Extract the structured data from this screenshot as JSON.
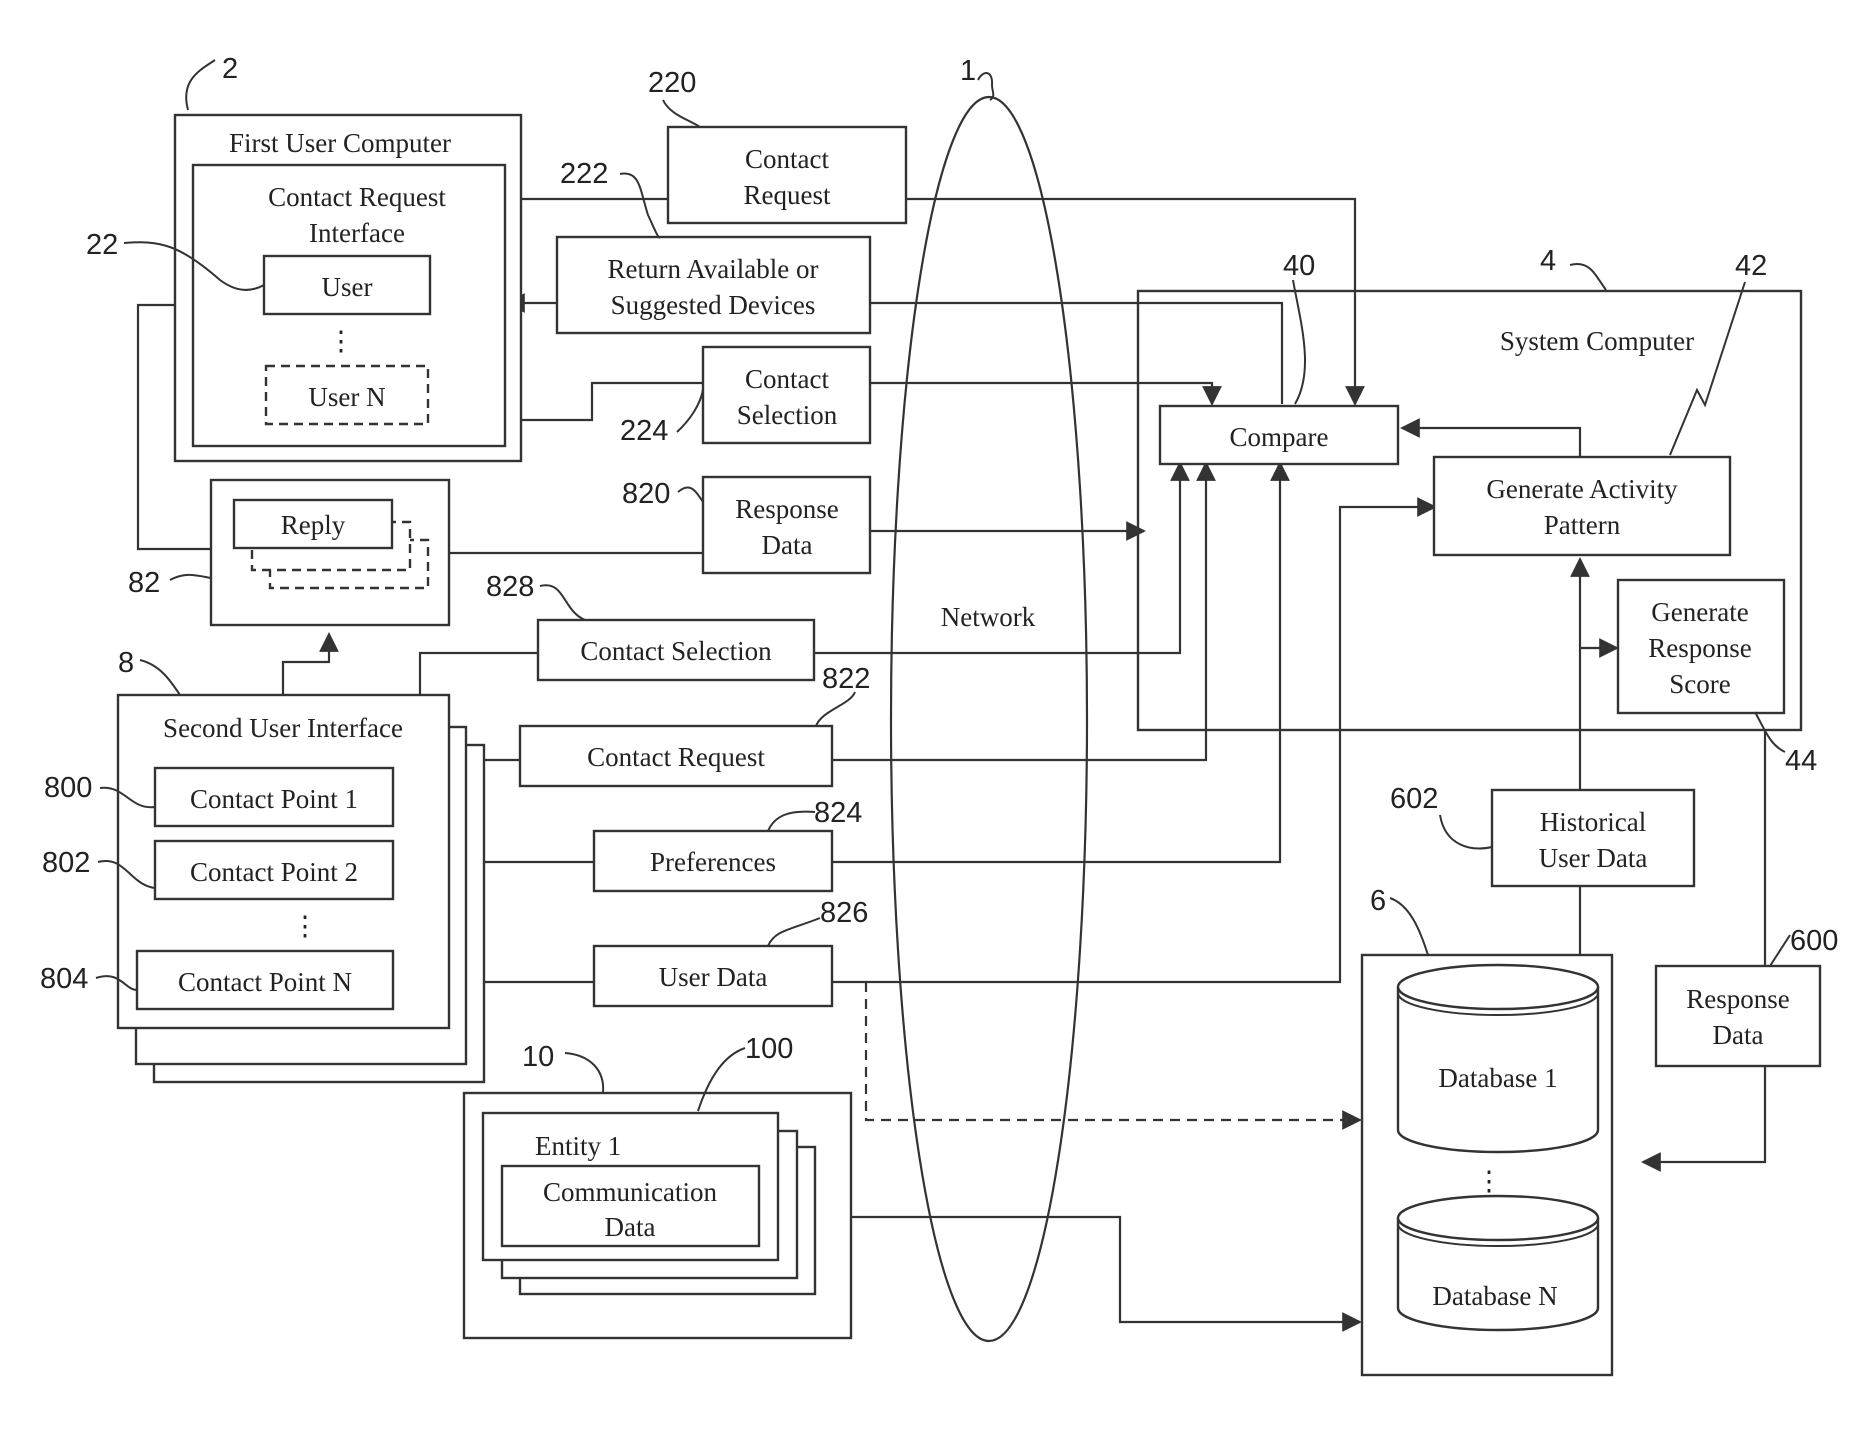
{
  "diagram": {
    "network": {
      "ref": "1",
      "label": "Network"
    },
    "first_user_computer": {
      "ref": "2",
      "title": "First User Computer",
      "interface_title_line1": "Contact Request",
      "interface_title_line2": "Interface",
      "user_ref": "22",
      "user_label": "User",
      "user_n_label": "User N"
    },
    "messages_top": {
      "contact_request": {
        "ref": "220",
        "line1": "Contact",
        "line2": "Request"
      },
      "return_devices": {
        "ref": "222",
        "line1": "Return Available or",
        "line2": "Suggested Devices"
      },
      "contact_selection": {
        "ref": "224",
        "line1": "Contact",
        "line2": "Selection"
      },
      "response_data": {
        "ref": "820",
        "line1": "Response",
        "line2": "Data"
      }
    },
    "reply": {
      "ref": "82",
      "label": "Reply"
    },
    "second_user_interface": {
      "ref": "8",
      "title": "Second User Interface",
      "contact_points": [
        {
          "ref": "800",
          "label": "Contact Point 1"
        },
        {
          "ref": "802",
          "label": "Contact Point 2"
        },
        {
          "ref": "804",
          "label": "Contact Point N"
        }
      ]
    },
    "messages_bottom": {
      "contact_selection": {
        "ref": "828",
        "label": "Contact Selection"
      },
      "contact_request": {
        "ref": "822",
        "label": "Contact Request"
      },
      "preferences": {
        "ref": "824",
        "label": "Preferences"
      },
      "user_data": {
        "ref": "826",
        "label": "User Data"
      }
    },
    "entity": {
      "ref": "10",
      "inner_ref": "100",
      "title": "Entity 1",
      "data_line1": "Communication",
      "data_line2": "Data"
    },
    "system_computer": {
      "ref": "4",
      "title": "System Computer",
      "compare": {
        "ref": "40",
        "label": "Compare"
      },
      "activity_pattern": {
        "ref": "42",
        "line1": "Generate Activity",
        "line2": "Pattern"
      },
      "response_score": {
        "ref": "44",
        "line1": "Generate",
        "line2": "Response",
        "line3": "Score"
      }
    },
    "historical_user_data": {
      "ref": "602",
      "line1": "Historical",
      "line2": "User Data"
    },
    "database_group": {
      "ref": "6",
      "db1": "Database 1",
      "dbn": "Database N"
    },
    "response_data_store": {
      "ref": "600",
      "line1": "Response",
      "line2": "Data"
    },
    "ellipsis": "⋮"
  }
}
